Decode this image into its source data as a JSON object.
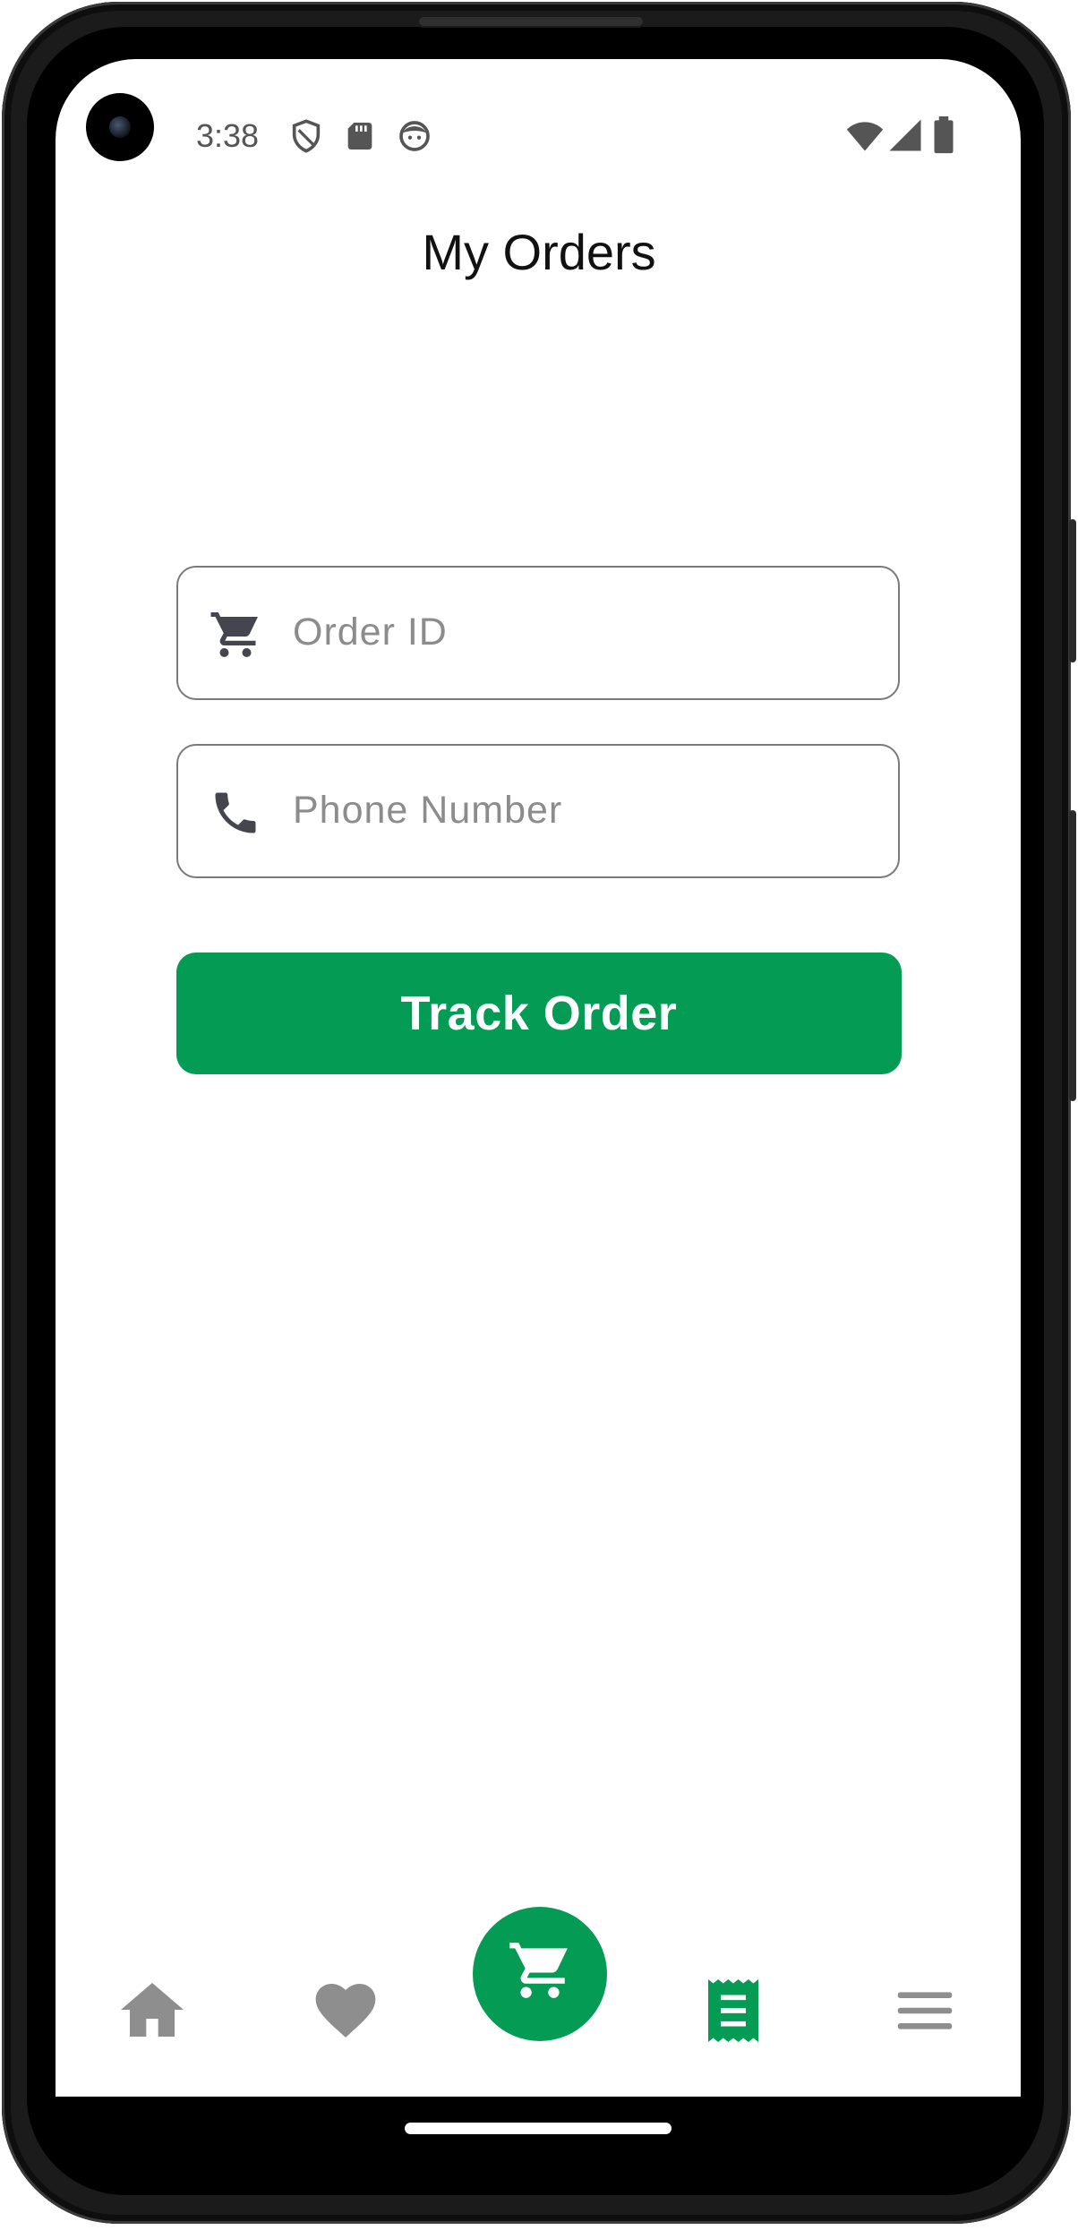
{
  "status_bar": {
    "time": "3:38",
    "left_icons": [
      "shield-icon",
      "sd-card-icon",
      "face-icon"
    ],
    "right_icons": [
      "wifi-icon",
      "signal-icon",
      "battery-icon"
    ]
  },
  "header": {
    "title": "My Orders"
  },
  "form": {
    "order_id": {
      "placeholder": "Order ID",
      "value": "",
      "icon": "cart-icon"
    },
    "phone": {
      "placeholder": "Phone Number",
      "value": "",
      "icon": "phone-icon"
    },
    "submit_label": "Track Order"
  },
  "bottom_nav": {
    "items": [
      {
        "icon": "home-icon",
        "active": false
      },
      {
        "icon": "heart-icon",
        "active": false
      },
      {
        "icon": "cart-icon",
        "active": false,
        "fab": true
      },
      {
        "icon": "receipt-icon",
        "active": true
      },
      {
        "icon": "menu-icon",
        "active": false
      }
    ]
  },
  "colors": {
    "accent": "#049b55",
    "icon_inactive": "#8e8e8e",
    "field_border": "#7a7a7a",
    "placeholder": "#8c8c8c"
  }
}
